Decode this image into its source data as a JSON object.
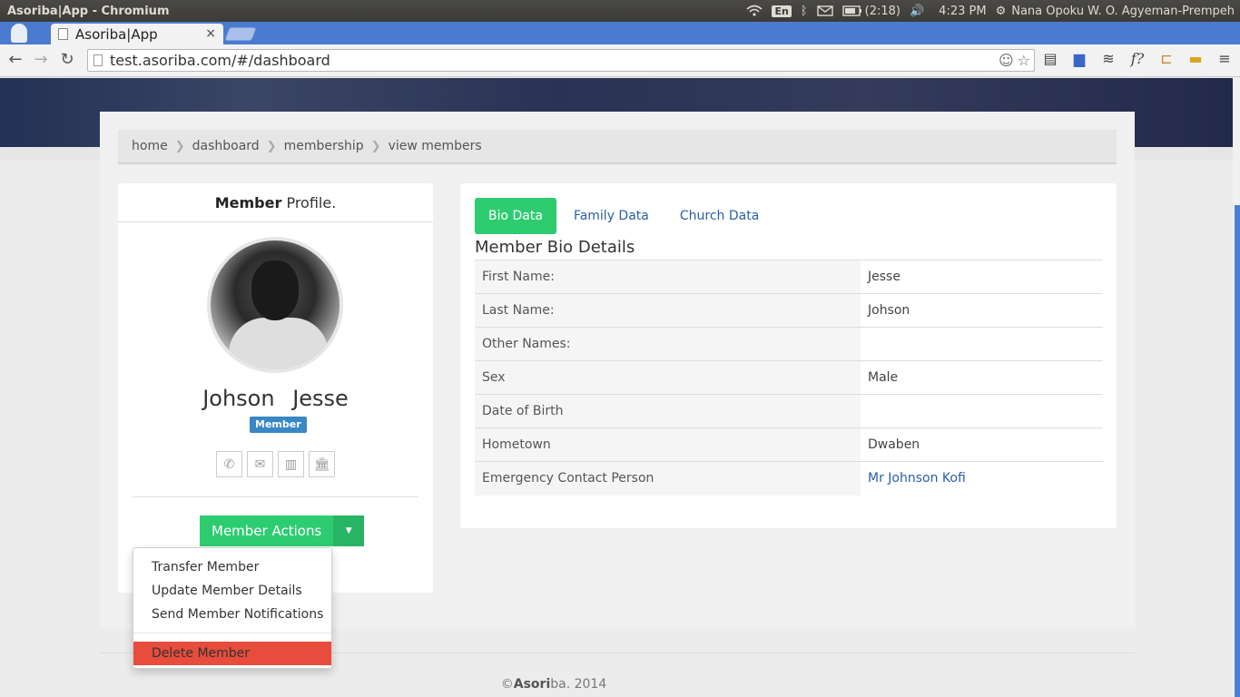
{
  "os": {
    "window_title": "Asoriba|App - Chromium",
    "lang": "En",
    "battery": "(2:18)",
    "clock": "4:23 PM",
    "user": "Nana Opoku W. O. Agyeman-Prempeh"
  },
  "browser": {
    "tab_title": "Asoriba|App",
    "tab_close": "×",
    "url": "test.asoriba.com/#/dashboard"
  },
  "breadcrumb": [
    "home",
    "dashboard",
    "membership",
    "view members"
  ],
  "profile": {
    "heading_bold": "Member",
    "heading_rest": " Profile.",
    "first_name": "Jesse",
    "last_name": "Johson",
    "full_name": "Johson  Jesse",
    "role": "Member",
    "actions_label": "Member Actions"
  },
  "actions_menu": {
    "items": [
      "Transfer Member",
      "Update Member Details",
      "Send Member Notifications"
    ],
    "danger": "Delete Member"
  },
  "details": {
    "tabs": [
      "Bio Data",
      "Family Data",
      "Church Data"
    ],
    "active_tab": "Bio Data",
    "section_title": "Member Bio Details",
    "rows": [
      {
        "label": "First Name:",
        "value": "Jesse"
      },
      {
        "label": "Last Name:",
        "value": "Johson"
      },
      {
        "label": "Other Names:",
        "value": ""
      },
      {
        "label": "Sex",
        "value": "Male"
      },
      {
        "label": "Date of Birth",
        "value": ""
      },
      {
        "label": "Hometown",
        "value": "Dwaben"
      },
      {
        "label": "Emergency Contact Person",
        "value": "Mr Johnson Kofi"
      }
    ]
  },
  "footer": {
    "copyright": "©",
    "brand_bold": "Asori",
    "brand_rest": "ba",
    "year": ". 2014"
  },
  "colors": {
    "accent_green": "#2ecc71",
    "danger_red": "#e74c3c",
    "badge_blue": "#3a87c8",
    "browser_blue": "#4b7bd0"
  }
}
